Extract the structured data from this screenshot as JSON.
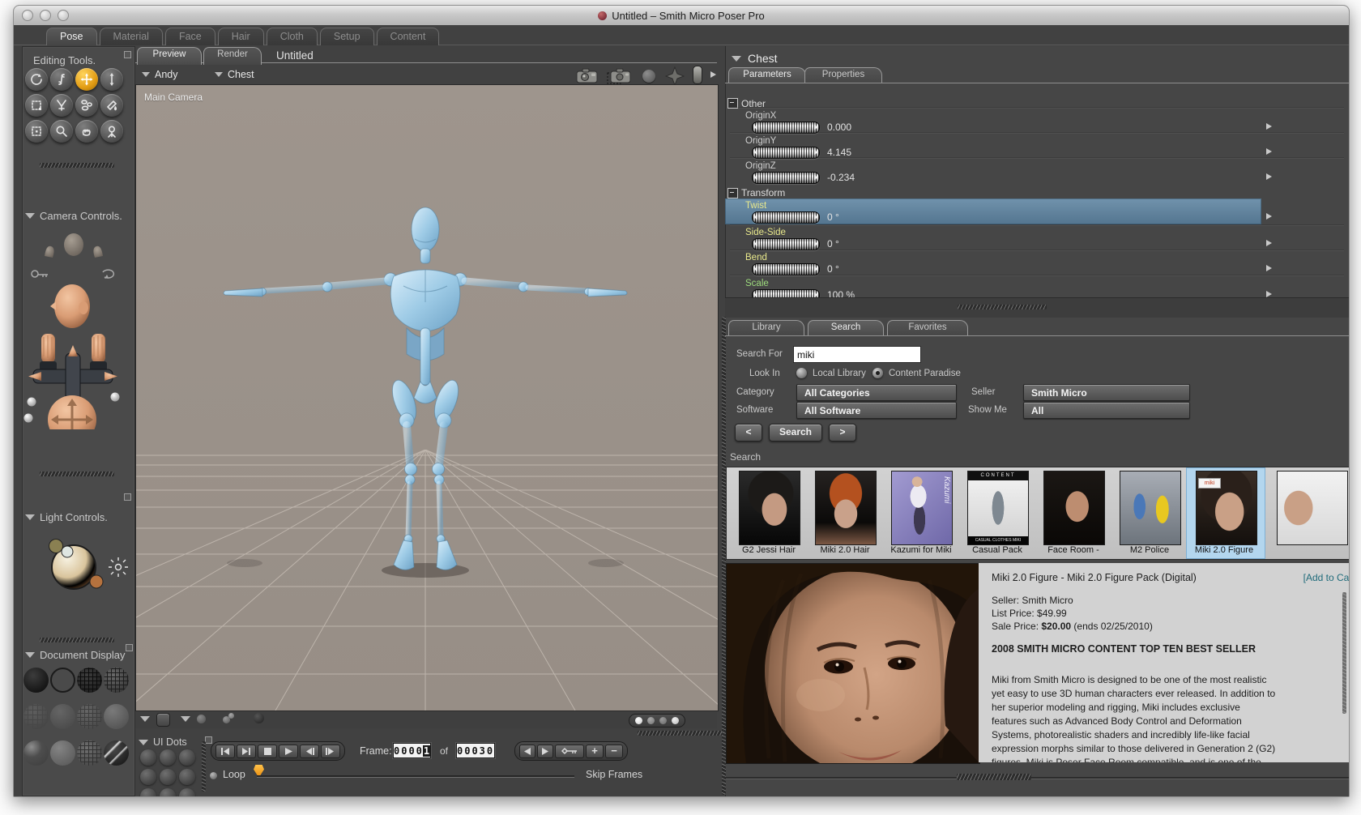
{
  "window": {
    "title": "Untitled – Smith Micro Poser Pro"
  },
  "room_tabs": {
    "items": [
      "Pose",
      "Material",
      "Face",
      "Hair",
      "Cloth",
      "Setup",
      "Content"
    ],
    "active": "Pose"
  },
  "sidebar": {
    "editing_tools": "Editing Tools.",
    "camera_controls": "Camera Controls.",
    "light_controls": "Light Controls.",
    "document_display": "Document Display",
    "ui_dots": "UI Dots"
  },
  "doc": {
    "tab_preview": "Preview",
    "tab_render": "Render",
    "title": "Untitled",
    "actor": "Andy",
    "part": "Chest",
    "camera_label": "Main Camera"
  },
  "params": {
    "header": "Chest",
    "tab_parameters": "Parameters",
    "tab_properties": "Properties",
    "group_other": "Other",
    "group_transform": "Transform",
    "rows": [
      {
        "label": "OriginX",
        "value": "0.000"
      },
      {
        "label": "OriginY",
        "value": "4.145"
      },
      {
        "label": "OriginZ",
        "value": "-0.234"
      },
      {
        "label": "Twist",
        "value": "0 °"
      },
      {
        "label": "Side-Side",
        "value": "0 °"
      },
      {
        "label": "Bend",
        "value": "0 °"
      },
      {
        "label": "Scale",
        "value": "100 %"
      }
    ]
  },
  "library": {
    "tab_library": "Library",
    "tab_search": "Search",
    "tab_favorites": "Favorites",
    "search_for_label": "Search For",
    "search_value": "miki",
    "look_in_label": "Look In",
    "option_local": "Local Library",
    "option_paradise": "Content Paradise",
    "category_label": "Category",
    "category_value": "All Categories",
    "seller_label": "Seller",
    "seller_value": "Smith Micro",
    "software_label": "Software",
    "software_value": "All Software",
    "show_me_label": "Show Me",
    "show_me_value": "All",
    "prev_button": "<",
    "search_button": "Search",
    "next_button": ">",
    "results_label": "Search",
    "results": [
      {
        "label": "G2 Jessi Hair"
      },
      {
        "label": "Miki 2.0 Hair"
      },
      {
        "label": "Kazumi for Miki",
        "art_text": "Kazumi"
      },
      {
        "label": "Casual Pack",
        "art_top": "CONTENT",
        "art_bottom": "CASUAL CLOTHES MIKI"
      },
      {
        "label": "Face Room -"
      },
      {
        "label": "M2 Police"
      },
      {
        "label": "Miki 2.0 Figure",
        "art_chip": "miki"
      }
    ],
    "detail": {
      "title": "Miki 2.0 Figure - Miki 2.0 Figure Pack (Digital)",
      "add_to_cart": "[Add to Cart]",
      "seller_line": "Seller: Smith Micro",
      "list_price_line": "List Price: $49.99",
      "sale_price_label": "Sale Price:",
      "sale_price_value": "$20.00",
      "sale_price_suffix": "(ends 02/25/2010)",
      "banner": "2008 SMITH MICRO CONTENT TOP TEN BEST SELLER",
      "description": "Miki from Smith Micro is designed to be one of the most realistic yet easy to use 3D human characters ever released. In addition to her superior modeling and rigging, Miki includes exclusive features such as Advanced Body Control and Deformation Systems, photorealistic shaders and incredibly life-like facial expression morphs similar to those delivered in Generation 2 (G2) figures. Miki is Poser Face Room compatible, and is one of the most"
    }
  },
  "animation": {
    "frame_label": "Frame:",
    "frame_prefix": "0000",
    "frame_last": "1",
    "of_label": "of",
    "frame_total": "00030",
    "loop_label": "Loop",
    "skip_frames_label": "Skip Frames"
  }
}
